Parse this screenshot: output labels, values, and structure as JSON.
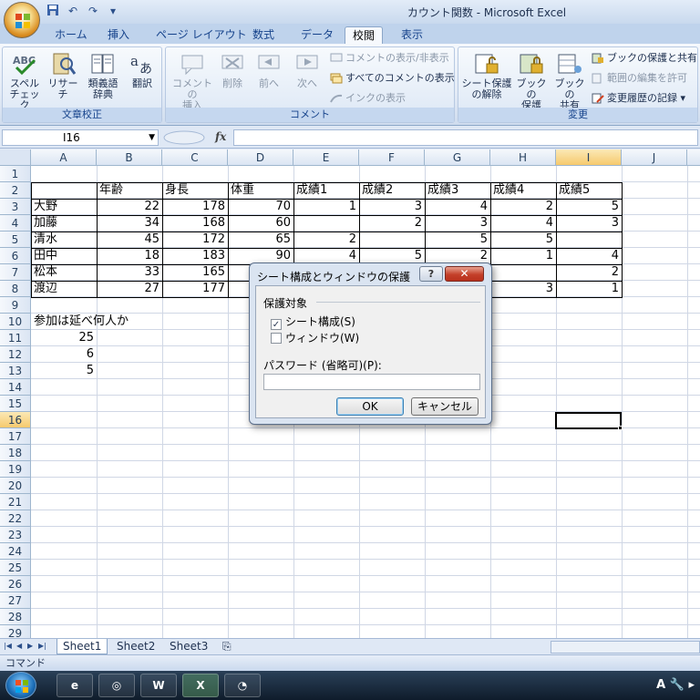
{
  "window": {
    "title": "カウント関数 - Microsoft Excel"
  },
  "quick_access": {
    "save_icon": "save-icon",
    "undo_icon": "undo-icon",
    "redo_icon": "redo-icon"
  },
  "tabs": [
    "ホーム",
    "挿入",
    "ページ レイアウト",
    "数式",
    "データ",
    "校閲",
    "表示"
  ],
  "active_tab": "校閲",
  "ribbon": {
    "proofing": {
      "label": "文章校正",
      "spell_line1": "スペル",
      "spell_line2": "チェック",
      "research": "リサーチ",
      "thesaurus_line1": "類義語",
      "thesaurus_line2": "辞典",
      "translate": "翻訳"
    },
    "comments": {
      "label": "コメント",
      "new_line1": "コメントの",
      "new_line2": "挿入",
      "delete": "削除",
      "prev": "前へ",
      "next": "次へ",
      "show_hide": "コメントの表示/非表示",
      "show_all": "すべてのコメントの表示",
      "show_ink": "インクの表示"
    },
    "changes": {
      "label": "変更",
      "unprotect_line1": "シート保護",
      "unprotect_line2": "の解除",
      "protect_book_line1": "ブックの",
      "protect_book_line2": "保護",
      "share_book_line1": "ブックの",
      "share_book_line2": "共有",
      "protect_share": "ブックの保護と共有",
      "allow_edit": "範囲の編集を許可",
      "track_changes": "変更履歴の記録"
    }
  },
  "formula_bar": {
    "name_box": "I16",
    "fx_label": "fx",
    "value": ""
  },
  "columns": [
    "A",
    "B",
    "C",
    "D",
    "E",
    "F",
    "G",
    "H",
    "I",
    "J"
  ],
  "selected_column": "I",
  "rows": [
    "1",
    "2",
    "3",
    "4",
    "5",
    "6",
    "7",
    "8",
    "9",
    "10",
    "11",
    "12",
    "13",
    "14",
    "15",
    "16",
    "17",
    "18",
    "19",
    "20",
    "21",
    "22",
    "23",
    "24",
    "25",
    "26",
    "27",
    "28",
    "29"
  ],
  "selected_row": "16",
  "table": {
    "headers": [
      "年齢",
      "身長",
      "体重",
      "成績1",
      "成績2",
      "成績3",
      "成績4",
      "成績5"
    ],
    "records": [
      {
        "name": "大野",
        "values": [
          "22",
          "178",
          "70",
          "1",
          "3",
          "4",
          "2",
          "5"
        ]
      },
      {
        "name": "加藤",
        "values": [
          "34",
          "168",
          "60",
          "",
          "2",
          "3",
          "4",
          "3"
        ]
      },
      {
        "name": "清水",
        "values": [
          "45",
          "172",
          "65",
          "2",
          "",
          "5",
          "5",
          ""
        ]
      },
      {
        "name": "田中",
        "values": [
          "18",
          "183",
          "90",
          "4",
          "5",
          "2",
          "1",
          "4"
        ]
      },
      {
        "name": "松本",
        "values": [
          "33",
          "165",
          "",
          "",
          "",
          "",
          "",
          "2"
        ]
      },
      {
        "name": "渡辺",
        "values": [
          "27",
          "177",
          "",
          "",
          "",
          "",
          "3",
          "1"
        ]
      }
    ]
  },
  "summary": {
    "label": "参加は延べ何人か",
    "values": [
      "25",
      "6",
      "5"
    ]
  },
  "sheets": [
    "Sheet1",
    "Sheet2",
    "Sheet3"
  ],
  "active_sheet": "Sheet1",
  "status": "コマンド",
  "dialog": {
    "title": "シート構成とウィンドウの保護",
    "help": "?",
    "close": "✕",
    "group_label": "保護対象",
    "option_structure": "シート構成(S)",
    "option_structure_checked": true,
    "option_window": "ウィンドウ(W)",
    "option_window_checked": false,
    "password_label": "パスワード (省略可)(P):",
    "password_value": "",
    "ok": "OK",
    "cancel": "キャンセル"
  },
  "taskbar": {
    "tray_text": "A"
  }
}
